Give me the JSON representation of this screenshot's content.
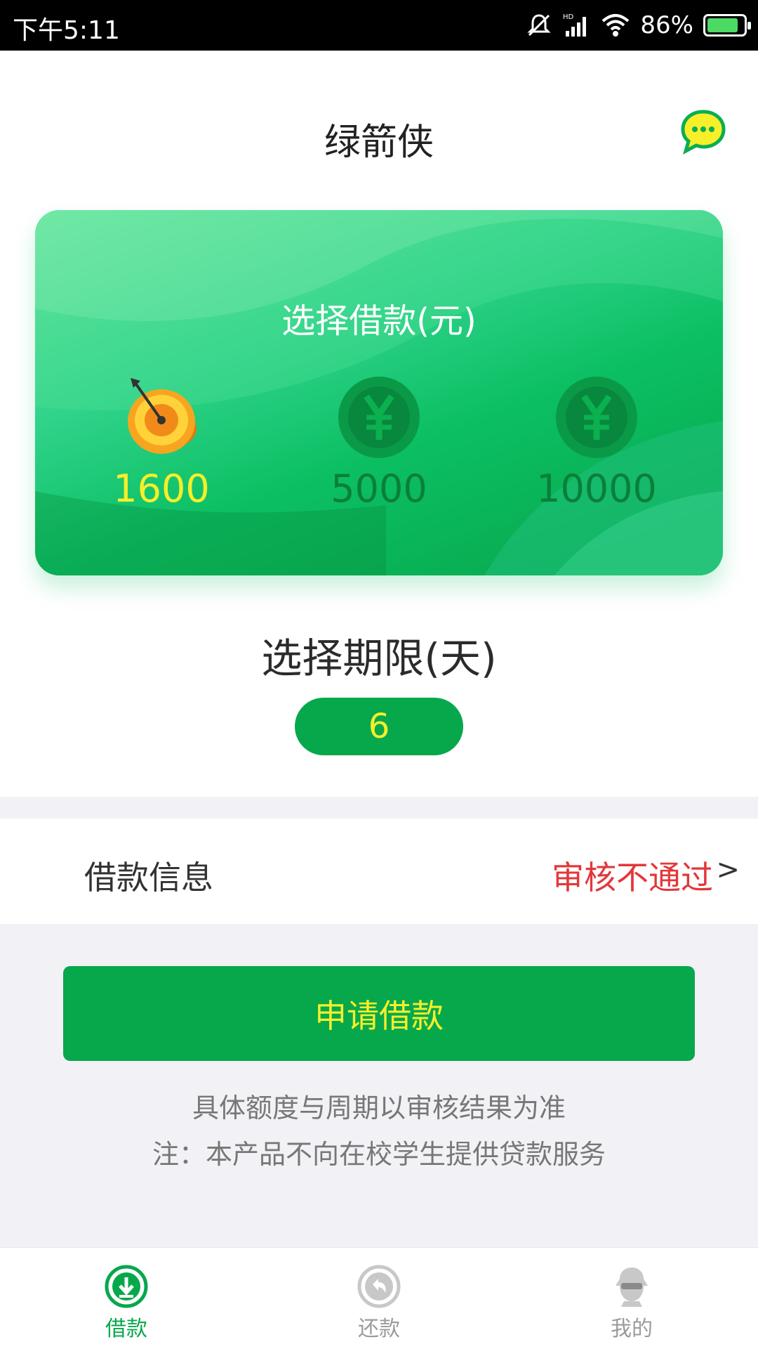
{
  "status_bar": {
    "time": "下午5:11",
    "battery_percent": "86%",
    "battery_level": 0.86
  },
  "header": {
    "title": "绿箭侠",
    "chat_icon": "chat-bubble-icon"
  },
  "amount_card": {
    "title": "选择借款(元)",
    "options": [
      {
        "value": "1600",
        "icon": "target-coin-icon",
        "selected": true
      },
      {
        "value": "5000",
        "icon": "yen-coin-icon",
        "selected": false
      },
      {
        "value": "10000",
        "icon": "yen-coin-icon",
        "selected": false
      }
    ]
  },
  "term": {
    "title": "选择期限(天)",
    "value": "6"
  },
  "loan_info": {
    "label": "借款信息",
    "status": "审核不通过",
    "arrow": ">"
  },
  "apply_button": {
    "label": "申请借款"
  },
  "notes": [
    "具体额度与周期以审核结果为准",
    "注：本产品不向在校学生提供贷款服务"
  ],
  "bottom_nav": {
    "items": [
      {
        "label": "借款",
        "icon": "borrow-icon",
        "active": true
      },
      {
        "label": "还款",
        "icon": "repay-icon",
        "active": false
      },
      {
        "label": "我的",
        "icon": "profile-icon",
        "active": false
      }
    ]
  },
  "colors": {
    "primary_green": "#07a84c",
    "highlight_yellow": "#f5ef2a",
    "error_red": "#e2383b"
  }
}
